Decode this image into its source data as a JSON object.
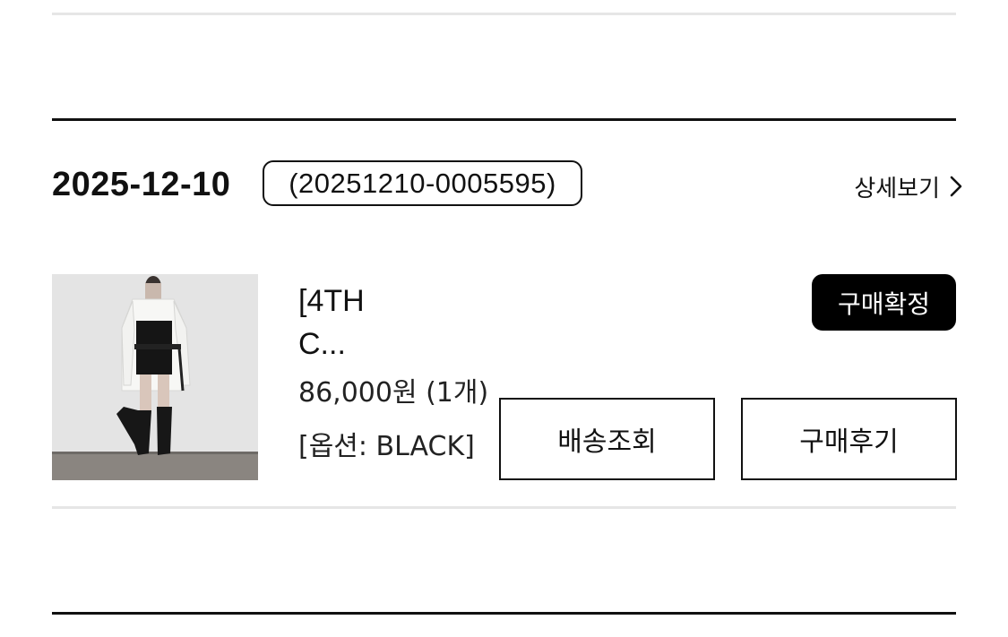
{
  "order": {
    "date": "2025-12-10",
    "order_number": "(20251210-0005595)",
    "detail_label": "상세보기"
  },
  "item": {
    "name_line1": "[4TH",
    "name_line2": "C...",
    "price": "86,000원 (1개)",
    "option": "[옵션: BLACK]",
    "status": "구매확정"
  },
  "actions": {
    "track_label": "배송조회",
    "review_label": "구매후기"
  },
  "icons": {
    "detail": "chevron-right-icon"
  },
  "colors": {
    "badge_bg": "#000000",
    "badge_text": "#ffffff",
    "divider_light": "#e6e6e6",
    "divider_dark": "#111111"
  }
}
